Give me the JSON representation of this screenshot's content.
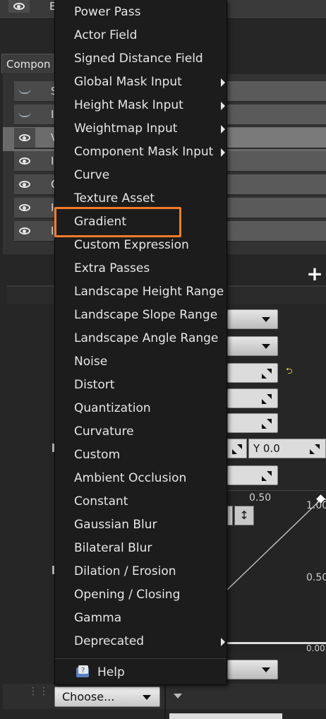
{
  "top_bar": {
    "partial_label": "E"
  },
  "components_tab": {
    "label": "Compon"
  },
  "component_rows": [
    {
      "visible": false,
      "letter": "S"
    },
    {
      "visible": false,
      "letter": "I"
    },
    {
      "visible": true,
      "letter": "V",
      "selected": true
    },
    {
      "visible": true,
      "letter": "I"
    },
    {
      "visible": true,
      "letter": "C"
    },
    {
      "visible": true,
      "letter": "I"
    },
    {
      "visible": true,
      "letter": "I"
    }
  ],
  "add_button": {
    "label": "+"
  },
  "properties": {
    "y_field": "Y  0.0"
  },
  "curve": {
    "top_label": "0.50",
    "right_top_label": "1.00",
    "right_mid_label": "0.50",
    "right_bottom_label": "0.00"
  },
  "choose": {
    "label": "Choose..."
  },
  "menu": {
    "items": [
      {
        "label": "Power Pass",
        "submenu": false
      },
      {
        "label": "Actor Field",
        "submenu": false
      },
      {
        "label": "Signed Distance Field",
        "submenu": false
      },
      {
        "label": "Global Mask Input",
        "submenu": true
      },
      {
        "label": "Height Mask Input",
        "submenu": true
      },
      {
        "label": "Weightmap Input",
        "submenu": true
      },
      {
        "label": "Component Mask Input",
        "submenu": true
      },
      {
        "label": "Curve",
        "submenu": false
      },
      {
        "label": "Texture Asset",
        "submenu": false
      },
      {
        "label": "Gradient",
        "submenu": false,
        "highlighted": true
      },
      {
        "label": "Custom Expression",
        "submenu": false
      },
      {
        "label": "Extra Passes",
        "submenu": false
      },
      {
        "label": "Landscape Height Range",
        "submenu": false
      },
      {
        "label": "Landscape Slope Range",
        "submenu": false
      },
      {
        "label": "Landscape Angle Range",
        "submenu": false
      },
      {
        "label": "Noise",
        "submenu": false
      },
      {
        "label": "Distort",
        "submenu": false
      },
      {
        "label": "Quantization",
        "submenu": false
      },
      {
        "label": "Curvature",
        "submenu": false
      },
      {
        "label": "Custom",
        "submenu": false
      },
      {
        "label": "Ambient Occlusion",
        "submenu": false
      },
      {
        "label": "Constant",
        "submenu": false
      },
      {
        "label": "Gaussian Blur",
        "submenu": false
      },
      {
        "label": "Bilateral Blur",
        "submenu": false
      },
      {
        "label": "Dilation / Erosion",
        "submenu": false
      },
      {
        "label": "Opening / Closing",
        "submenu": false
      },
      {
        "label": "Gamma",
        "submenu": false
      },
      {
        "label": "Deprecated",
        "submenu": true
      }
    ],
    "help_label": "Help"
  },
  "colors": {
    "highlight": "#f37c2a",
    "menu_bg": "#1c1c1c",
    "panel_bg": "#262626"
  }
}
